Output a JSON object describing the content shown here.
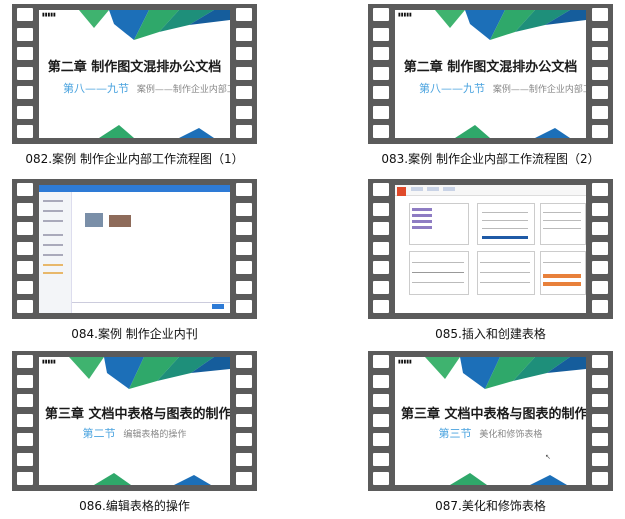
{
  "videos": [
    {
      "caption": "082.案例 制作企业内部工作流程图（1）",
      "kind": "title-slide",
      "chapter_title": "第二章  制作图文混排办公文档",
      "section_label": "第八——九节",
      "section_desc": "案例——制作企业内部工作"
    },
    {
      "caption": "083.案例 制作企业内部工作流程图（2）",
      "kind": "title-slide",
      "chapter_title": "第二章  制作图文混排办公文档",
      "section_label": "第八——九节",
      "section_desc": "案例——制作企业内部工作"
    },
    {
      "caption": "084.案例 制作企业内刊",
      "kind": "app-screenshot"
    },
    {
      "caption": "085.插入和创建表格",
      "kind": "spreadsheet-screenshot"
    },
    {
      "caption": "086.编辑表格的操作",
      "kind": "title-slide",
      "chapter_title": "第三章  文档中表格与图表的制作和编",
      "section_label": "第二节",
      "section_desc": "编辑表格的操作"
    },
    {
      "caption": "087.美化和修饰表格",
      "kind": "title-slide",
      "chapter_title": "第三章  文档中表格与图表的制作和编",
      "section_label": "第三节",
      "section_desc": "美化和修饰表格"
    }
  ],
  "colors": {
    "film": "#5b5b5b",
    "section_accent": "#4aa3df",
    "deco_green": "#2fa86a",
    "deco_blue": "#1c6fb8"
  }
}
